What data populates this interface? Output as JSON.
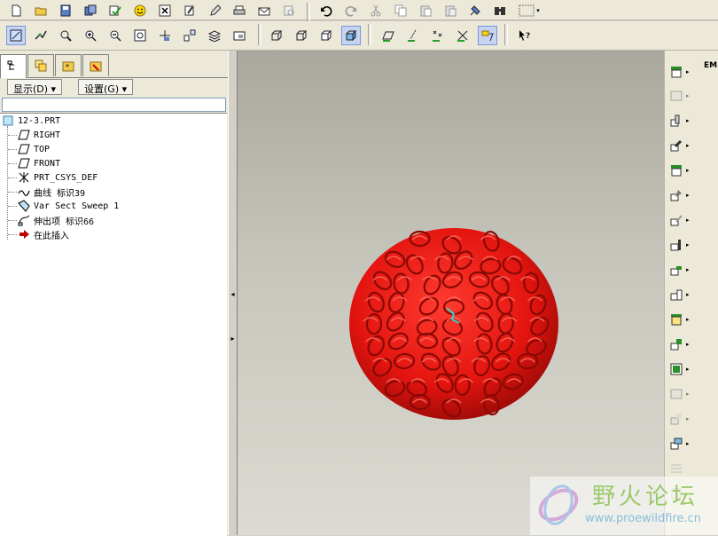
{
  "colors": {
    "model_red": "#e3140f",
    "viewport_top": "#a9a89e",
    "viewport_bottom": "#dcdbd3",
    "panel_bg": "#ece9d8",
    "watermark_green": "#9bc96a",
    "watermark_blue": "#88bfd9"
  },
  "toolbar_top": {
    "icons": [
      "new-file-icon",
      "open-folder-icon",
      "save-icon",
      "save-copy-icon",
      "check-icon",
      "smiley-icon",
      "close-window-icon",
      "regenerate-icon",
      "edit-icon",
      "print-icon",
      "mail-icon",
      "link-icon",
      "undo-icon",
      "redo-icon",
      "cut-icon",
      "copy-icon",
      "paste-icon",
      "paste-special-icon",
      "regenerate-all-icon",
      "find-icon",
      "select-box-icon"
    ]
  },
  "toolbar_view": {
    "icons": [
      "repaint-icon",
      "spin-center-icon",
      "orient-icon",
      "zoom-in-icon",
      "zoom-out-icon",
      "refit-icon",
      "reorient-icon",
      "view-manager-icon",
      "layers-icon",
      "saved-views-icon",
      "wireframe-icon",
      "hidden-line-icon",
      "no-hidden-icon",
      "shading-icon",
      "datum-planes-icon",
      "datum-axes-icon",
      "datum-points-icon",
      "csys-icon",
      "annotations-icon",
      "context-help-icon"
    ]
  },
  "nav_tabs": [
    "model-tree-tab",
    "layer-tree-tab",
    "folder-browser-tab",
    "favorites-tab"
  ],
  "menus": {
    "show": "显示(D) ▾",
    "settings": "设置(G) ▾"
  },
  "tree": {
    "root": "12-3.PRT",
    "items": [
      {
        "label": "RIGHT",
        "icon": "datum-plane-icon"
      },
      {
        "label": "TOP",
        "icon": "datum-plane-icon"
      },
      {
        "label": "FRONT",
        "icon": "datum-plane-icon"
      },
      {
        "label": "PRT_CSYS_DEF",
        "icon": "coordinate-system-icon"
      },
      {
        "label": "曲线 标识39",
        "icon": "curve-icon"
      },
      {
        "label": "Var Sect Sweep 1",
        "icon": "sweep-icon"
      },
      {
        "label": "伸出项 标识66",
        "icon": "protrusion-icon"
      },
      {
        "label": "在此插入",
        "icon": "insert-here-arrow-icon"
      }
    ]
  },
  "right_toolbar": {
    "icons": [
      "hole-icon",
      "shell-icon",
      "rib-icon",
      "draft-icon",
      "round-icon",
      "chamfer-icon",
      "sketch-icon",
      "extrude-icon",
      "revolve-icon",
      "sweep-icon",
      "blend-icon",
      "variable-sweep-icon",
      "swept-blend-icon",
      "helical-sweep-icon",
      "boundary-blend-icon",
      "style-icon",
      "datum-icon",
      "pattern-icon"
    ],
    "top_label": "EM"
  },
  "watermark": {
    "title": "野火论坛",
    "url": "www.proewildfire.cn"
  }
}
